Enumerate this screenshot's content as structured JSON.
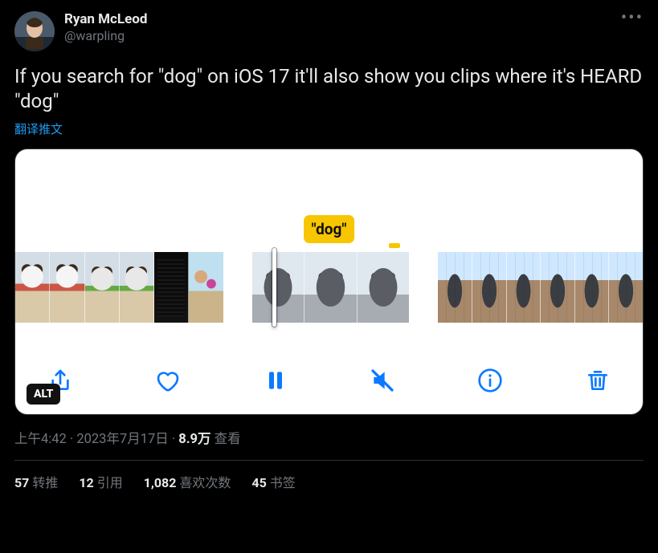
{
  "author": {
    "display_name": "Ryan McLeod",
    "handle": "@warpling"
  },
  "tweet_text": "If you search for \"dog\" on iOS 17 it'll also show you clips where it's HEARD \"dog\"",
  "translate_link": "翻译推文",
  "media": {
    "search_chip": "\"dog\"",
    "alt_badge": "ALT",
    "toolbar_icons": [
      "share",
      "heart",
      "pause",
      "mute",
      "info",
      "trash"
    ]
  },
  "meta": {
    "time": "上午4:42",
    "date": "2023年7月17日",
    "views_count": "8.9万",
    "views_label": "查看",
    "separator": " · "
  },
  "stats": {
    "retweets": {
      "count": "57",
      "label": "转推"
    },
    "quotes": {
      "count": "12",
      "label": "引用"
    },
    "likes": {
      "count": "1,082",
      "label": "喜欢次数"
    },
    "bookmarks": {
      "count": "45",
      "label": "书签"
    }
  }
}
